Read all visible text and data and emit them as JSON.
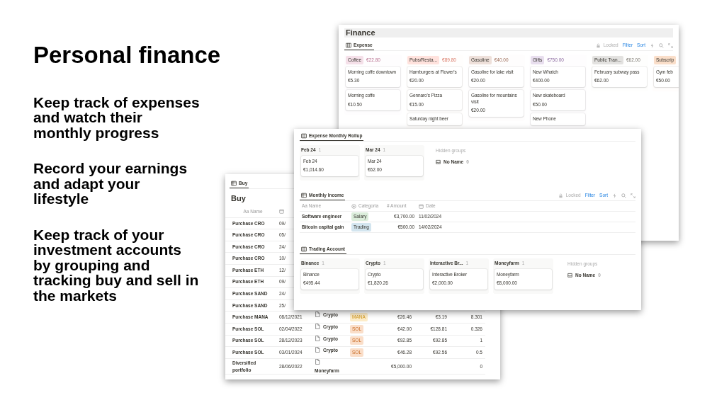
{
  "headline": "Personal finance",
  "points": [
    "Keep track of expenses\nand watch their\nmonthly progress",
    "Record your earnings\nand adapt your\nlifestyle",
    "Keep track of your\ninvestment accounts\nby grouping and\ntracking buy and sell in\nthe markets"
  ],
  "finance_window": {
    "title": "Finance",
    "view": "Expense",
    "toolbar": {
      "locked": "Locked",
      "filter": "Filter",
      "sort": "Sort"
    },
    "groups": [
      {
        "name": "Coffee",
        "total": "€22.80",
        "color": "#f5e0e9",
        "cards": [
          {
            "title": "Morning coffe downtown",
            "amount": "€5.30"
          },
          {
            "title": "Morning coffe",
            "amount": "€10.50"
          }
        ]
      },
      {
        "name": "Pubs/Resta...",
        "total": "€89.80",
        "color": "#ffe2dd",
        "cards": [
          {
            "title": "Hamburgers at Flower's",
            "amount": "€20.00"
          },
          {
            "title": "Gennaro's Pizza",
            "amount": "€15.00"
          },
          {
            "title": "Saturday night beer"
          }
        ]
      },
      {
        "name": "Gasoline",
        "total": "€40.00",
        "color": "#eee0da",
        "cards": [
          {
            "title": "Gasoline for lake visit",
            "amount": "€20.00"
          },
          {
            "title": "Gasoline for mountains visit",
            "amount": "€20.00"
          }
        ]
      },
      {
        "name": "Gifts",
        "total": "€750.00",
        "color": "#e8deee",
        "cards": [
          {
            "title": "New Whatch",
            "amount": "€400.00"
          },
          {
            "title": "New skateboard",
            "amount": "€50.00"
          },
          {
            "title": "New Phone"
          }
        ]
      },
      {
        "name": "Public Tran...",
        "total": "€62.00",
        "color": "#e3e2e0",
        "cards": [
          {
            "title": "February subway pass",
            "amount": "€62.00"
          }
        ]
      },
      {
        "name": "Subscrip",
        "color": "#fadec9",
        "cards": [
          {
            "title": "Gym feb",
            "amount": "€50.00"
          }
        ]
      }
    ]
  },
  "buy_window": {
    "view": "Buy",
    "title": "Buy",
    "columns": [
      "Aa Name"
    ],
    "rows": [
      {
        "name": "Purchase CRO",
        "date": "09/"
      },
      {
        "name": "Purchase CRO",
        "date": "05/"
      },
      {
        "name": "Purchase CRO",
        "date": "24/"
      },
      {
        "name": "Purchase CRO",
        "date": "10/"
      },
      {
        "name": "Purchase ETH",
        "date": "12/"
      },
      {
        "name": "Purchase ETH",
        "date": "09/"
      },
      {
        "name": "Purchase SAND",
        "date": "24/"
      },
      {
        "name": "Purchase SAND",
        "date": "25/"
      },
      {
        "name": "Purchase MANA",
        "date": "08/12/2021",
        "account": "Crypto",
        "tag": {
          "label": "MANA",
          "color": "#fdecc8"
        },
        "amount": "€26.46",
        "price": "€3.19",
        "quantity": "8.301"
      },
      {
        "name": "Purchase SOL",
        "date": "02/04/2022",
        "account": "Crypto",
        "tag": {
          "label": "SOL",
          "color": "#fadec9"
        },
        "amount": "€42.00",
        "price": "€128.81",
        "quantity": "0.326"
      },
      {
        "name": "Purchase SOL",
        "date": "28/12/2023",
        "account": "Crypto",
        "tag": {
          "label": "SOL",
          "color": "#fadec9"
        },
        "amount": "€92.85",
        "price": "€92.85",
        "quantity": "1"
      },
      {
        "name": "Purchase SOL",
        "date": "03/01/2024",
        "account": "Crypto",
        "tag": {
          "label": "SOL",
          "color": "#fadec9"
        },
        "amount": "€46.28",
        "price": "€92.56",
        "quantity": "0.5"
      },
      {
        "name": "Diversified portfolio",
        "date": "28/06/2022",
        "account": "Moneyfarm",
        "amount": "€5,000.00",
        "quantity": "0"
      }
    ]
  },
  "rollup_window": {
    "rollup": {
      "view": "Expense Monthly Rollup",
      "groups": [
        {
          "name": "Feb 24",
          "count": "1",
          "cards": [
            {
              "title": "Feb 24",
              "amount": "€1,014.60"
            }
          ]
        },
        {
          "name": "Mar 24",
          "count": "1",
          "cards": [
            {
              "title": "Mar 24",
              "amount": "€62.00"
            }
          ]
        }
      ],
      "hidden": {
        "label": "Hidden groups",
        "name": "No Name",
        "count": "0"
      }
    },
    "income": {
      "view": "Monthly Income",
      "toolbar": {
        "locked": "Locked",
        "filter": "Filter",
        "sort": "Sort"
      },
      "columns": [
        {
          "label": "Aa Name",
          "kind": "text"
        },
        {
          "label": "Categoria",
          "kind": "select"
        },
        {
          "label": "# Amount",
          "kind": "number"
        },
        {
          "label": "Date",
          "kind": "date"
        }
      ],
      "rows": [
        {
          "name": "Software engineer",
          "category": {
            "label": "Salary",
            "color": "#dbeddb"
          },
          "amount": "€3,700.00",
          "date": "11/02/2024"
        },
        {
          "name": "Bitcoin capital gain",
          "category": {
            "label": "Trading",
            "color": "#d3e5ef"
          },
          "amount": "€500.00",
          "date": "14/02/2024"
        }
      ]
    },
    "trading": {
      "view": "Trading Account",
      "groups": [
        {
          "name": "Binance",
          "count": "1",
          "cards": [
            {
              "title": "Binance",
              "amount": "€495.44"
            }
          ]
        },
        {
          "name": "Crypto",
          "count": "1",
          "cards": [
            {
              "title": "Crypto",
              "amount": "€1,820.26"
            }
          ]
        },
        {
          "name": "Interactive Br...",
          "count": "1",
          "cards": [
            {
              "title": "Interactive Broker",
              "amount": "€2,000.00"
            }
          ]
        },
        {
          "name": "Moneyfarm",
          "count": "1",
          "cards": [
            {
              "title": "Moneyfarm",
              "amount": "€8,000.00"
            }
          ]
        }
      ],
      "hidden": {
        "label": "Hidden groups",
        "name": "No Name",
        "count": "0"
      }
    }
  }
}
